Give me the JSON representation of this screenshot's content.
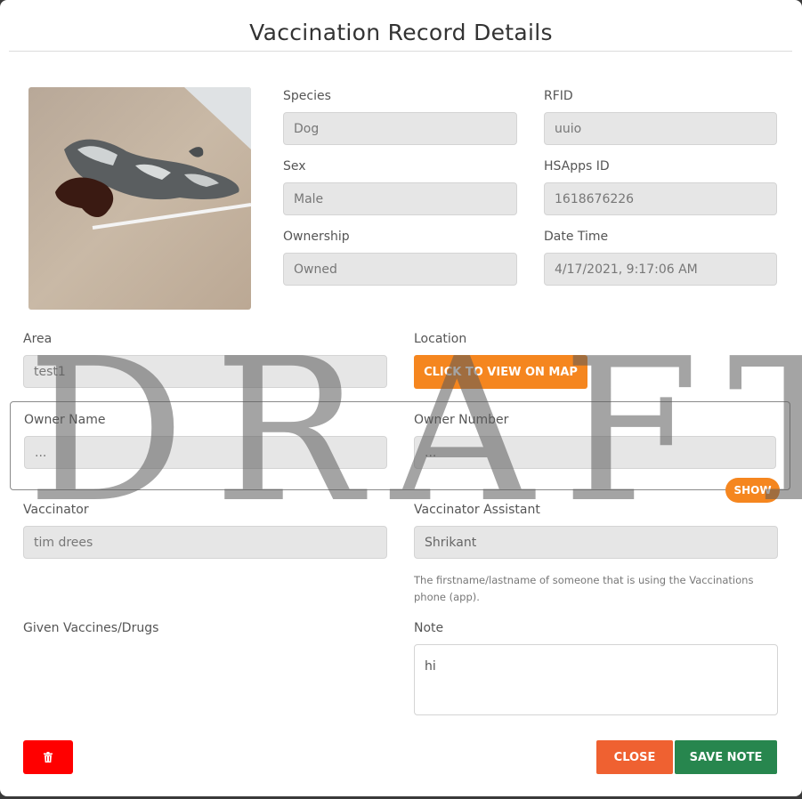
{
  "modal": {
    "title": "Vaccination Record Details"
  },
  "details": {
    "species": {
      "label": "Species",
      "value": "Dog"
    },
    "rfid": {
      "label": "RFID",
      "value": "uuio"
    },
    "sex": {
      "label": "Sex",
      "value": "Male"
    },
    "hsapps_id": {
      "label": "HSApps ID",
      "value": "1618676226"
    },
    "ownership": {
      "label": "Ownership",
      "value": "Owned"
    },
    "date_time": {
      "label": "Date Time",
      "value": "4/17/2021, 9:17:06 AM"
    }
  },
  "area": {
    "label": "Area",
    "value": "test1"
  },
  "location": {
    "label": "Location",
    "button_label": "CLICK TO VIEW ON MAP"
  },
  "owner": {
    "name": {
      "label": "Owner Name",
      "value": "..."
    },
    "number": {
      "label": "Owner Number",
      "value": "..."
    },
    "show_label": "SHOW"
  },
  "vaccinator": {
    "label": "Vaccinator",
    "value": "tim drees"
  },
  "vaccinator_assistant": {
    "label": "Vaccinator Assistant",
    "value": "Shrikant",
    "hint": "The firstname/lastname of someone that is using the Vaccinations phone (app)."
  },
  "vaccines": {
    "label": "Given Vaccines/Drugs"
  },
  "note": {
    "label": "Note",
    "value": "hi"
  },
  "footer": {
    "delete_icon": "trash-icon",
    "close_label": "CLOSE",
    "save_label": "SAVE NOTE"
  },
  "watermark": {
    "text": "DRAFT"
  },
  "colors": {
    "accent_orange": "#f5861f",
    "close_orange": "#ef6131",
    "save_green": "#27864e",
    "delete_red": "#ff0000"
  }
}
